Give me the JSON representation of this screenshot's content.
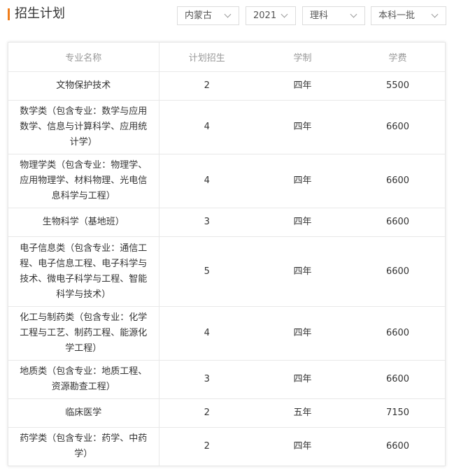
{
  "header": {
    "title": "招生计划",
    "filters": {
      "province": "内蒙古",
      "year": "2021",
      "subject": "理科",
      "batch": "本科一批"
    }
  },
  "table": {
    "columns": [
      "专业名称",
      "计划招生",
      "学制",
      "学费"
    ],
    "rows": [
      {
        "name": "文物保护技术",
        "plan": "2",
        "duration": "四年",
        "fee": "5500"
      },
      {
        "name": "数学类（包含专业：数学与应用数学、信息与计算科学、应用统计学）",
        "plan": "4",
        "duration": "四年",
        "fee": "6600"
      },
      {
        "name": "物理学类（包含专业：物理学、应用物理学、材料物理、光电信息科学与工程）",
        "plan": "4",
        "duration": "四年",
        "fee": "6600"
      },
      {
        "name": "生物科学（基地班）",
        "plan": "3",
        "duration": "四年",
        "fee": "6600"
      },
      {
        "name": "电子信息类（包含专业：通信工程、电子信息工程、电子科学与技术、微电子科学与工程、智能科学与技术）",
        "plan": "5",
        "duration": "四年",
        "fee": "6600"
      },
      {
        "name": "化工与制药类（包含专业：化学工程与工艺、制药工程、能源化学工程）",
        "plan": "4",
        "duration": "四年",
        "fee": "6600"
      },
      {
        "name": "地质类（包含专业：地质工程、资源勘查工程）",
        "plan": "3",
        "duration": "四年",
        "fee": "6600"
      },
      {
        "name": "临床医学",
        "plan": "2",
        "duration": "五年",
        "fee": "7150"
      },
      {
        "name": "药学类（包含专业：药学、中药学）",
        "plan": "2",
        "duration": "四年",
        "fee": "6600"
      }
    ]
  },
  "colors": {
    "accent": "#f07d1a",
    "header_text": "#999999",
    "border": "#e8e8e8"
  }
}
